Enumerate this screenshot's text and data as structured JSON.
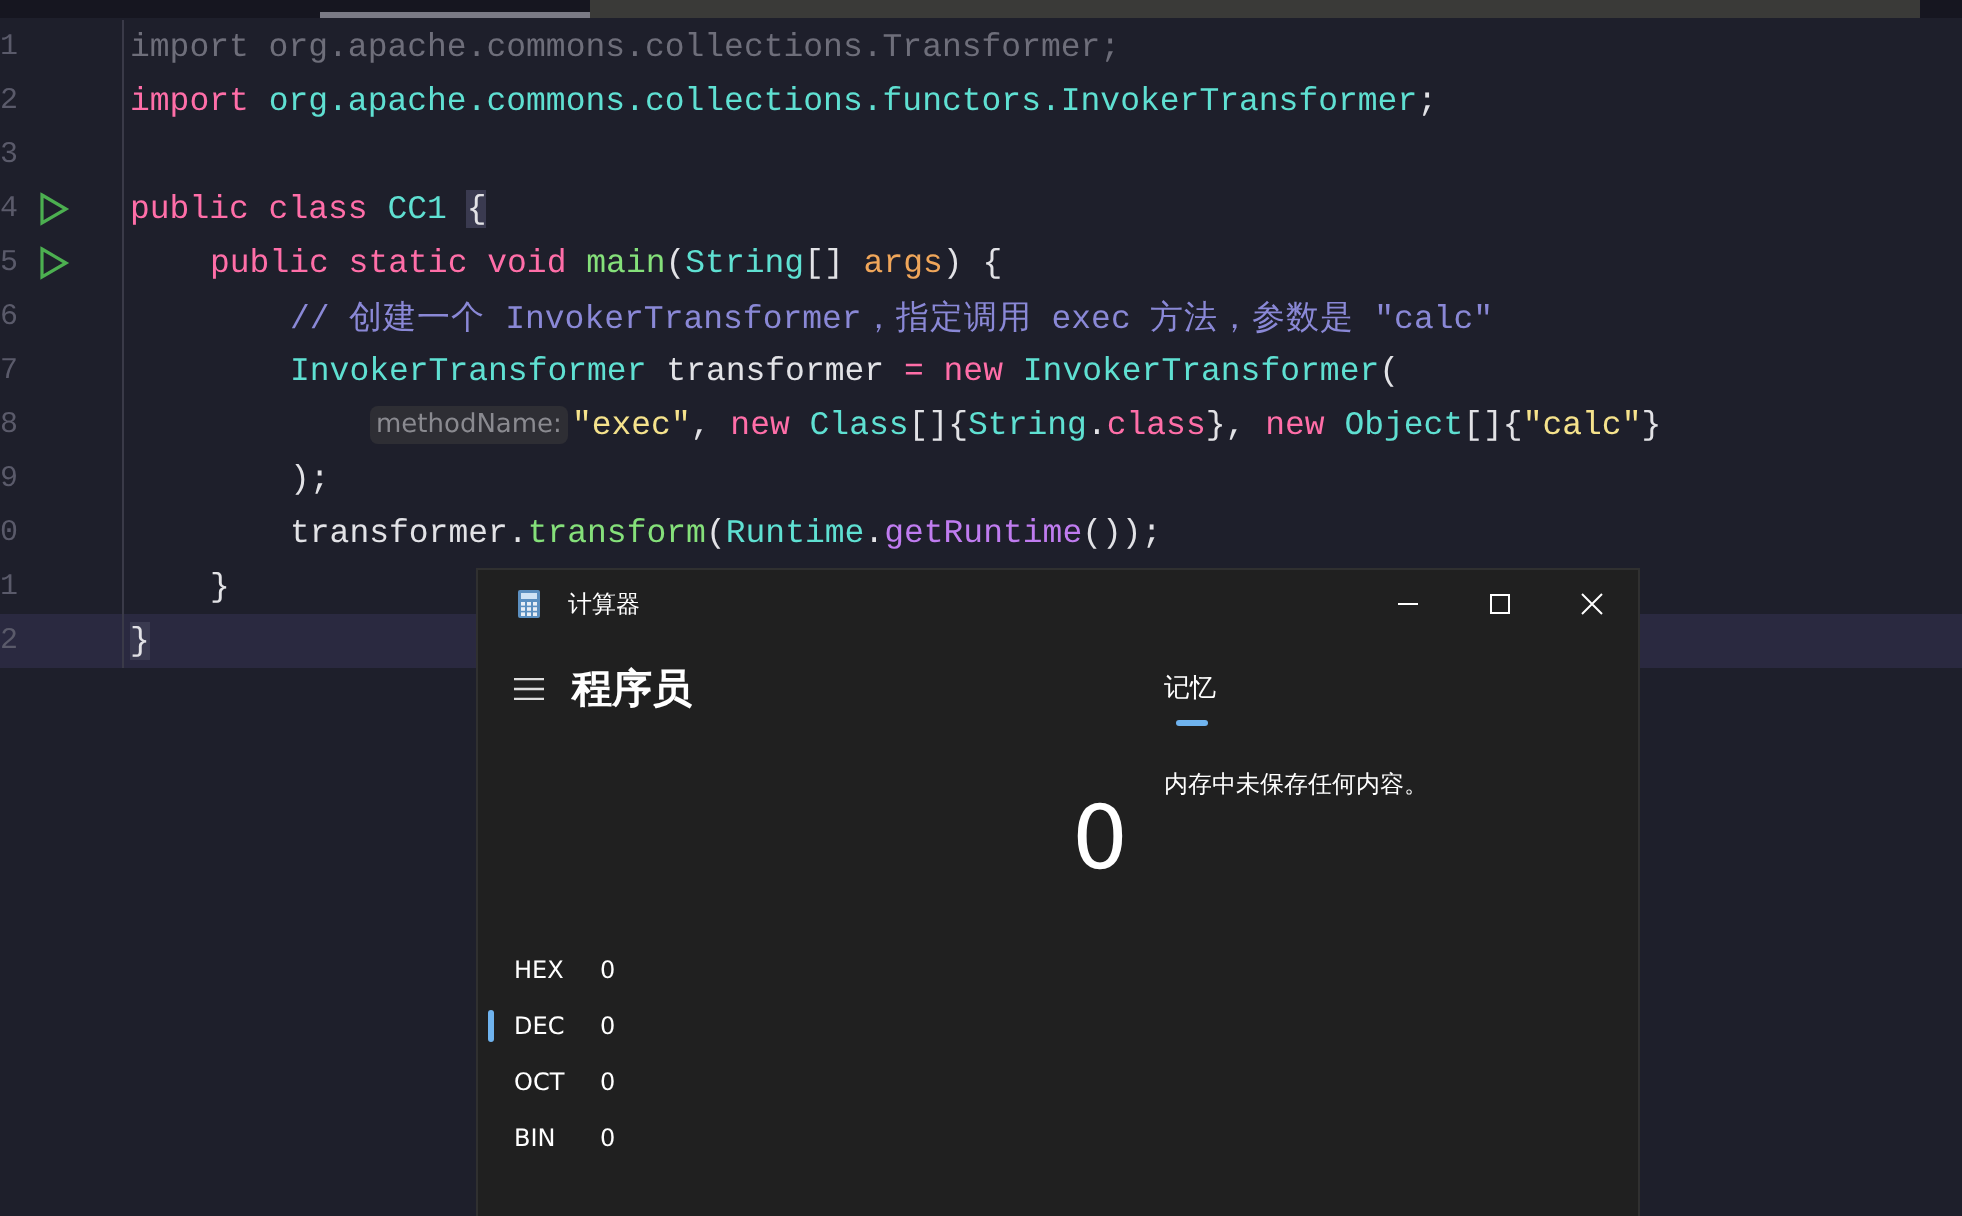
{
  "editor": {
    "lines": [
      {
        "number": "1",
        "tokens": [
          {
            "kind": "unused",
            "text": "import org.apache.commons.collections.Transformer;"
          }
        ]
      },
      {
        "number": "2",
        "tokens": [
          {
            "kind": "keyword",
            "text": "import "
          },
          {
            "kind": "type",
            "text": "org.apache.commons.collections.functors.InvokerTransformer"
          },
          {
            "kind": "plain",
            "text": ";"
          }
        ]
      },
      {
        "number": "3"
      },
      {
        "number": "4",
        "run_icon": true,
        "tokens": [
          {
            "kind": "keyword",
            "text": "public class "
          },
          {
            "kind": "type",
            "text": "CC1 "
          },
          {
            "kind": "brace",
            "text": "{"
          }
        ],
        "children": [
          {
            "number": "5",
            "run_icon": true,
            "tokens": [
              {
                "kind": "keyword",
                "text": "public static void "
              },
              {
                "kind": "method",
                "text": "main"
              },
              {
                "kind": "plain",
                "text": "("
              },
              {
                "kind": "type",
                "text": "String"
              },
              {
                "kind": "plain",
                "text": "[] "
              },
              {
                "kind": "param",
                "text": "args"
              },
              {
                "kind": "plain",
                "text": ") {"
              }
            ],
            "children": [
              {
                "number": "6",
                "tokens": [
                  {
                    "kind": "comment",
                    "text": "// 创建一个 InvokerTransformer，指定调用 exec 方法，参数是 \"calc\""
                  }
                ]
              },
              {
                "number": "7",
                "tokens": [
                  {
                    "kind": "type",
                    "text": "InvokerTransformer "
                  },
                  {
                    "kind": "plain",
                    "text": "transformer "
                  },
                  {
                    "kind": "keyword",
                    "text": "= new "
                  },
                  {
                    "kind": "type",
                    "text": "InvokerTransformer"
                  },
                  {
                    "kind": "plain",
                    "text": "("
                  }
                ],
                "children": [
                  {
                    "number": "8",
                    "tokens": [
                      {
                        "kind": "hint",
                        "text": "methodName:"
                      },
                      {
                        "kind": "string",
                        "text": "\"exec\""
                      },
                      {
                        "kind": "plain",
                        "text": ", "
                      },
                      {
                        "kind": "keyword",
                        "text": "new "
                      },
                      {
                        "kind": "type",
                        "text": "Class"
                      },
                      {
                        "kind": "plain",
                        "text": "[]{"
                      },
                      {
                        "kind": "type",
                        "text": "String"
                      },
                      {
                        "kind": "plain",
                        "text": "."
                      },
                      {
                        "kind": "keyword",
                        "text": "class"
                      },
                      {
                        "kind": "plain",
                        "text": "}, "
                      },
                      {
                        "kind": "keyword",
                        "text": "new "
                      },
                      {
                        "kind": "type",
                        "text": "Object"
                      },
                      {
                        "kind": "plain",
                        "text": "[]{"
                      },
                      {
                        "kind": "string",
                        "text": "\"calc\""
                      },
                      {
                        "kind": "plain",
                        "text": "}"
                      }
                    ]
                  }
                ]
              },
              {
                "number": "9",
                "tokens": [
                  {
                    "kind": "plain",
                    "text": ");"
                  }
                ]
              },
              {
                "number": "0",
                "tokens": [
                  {
                    "kind": "plain",
                    "text": "transformer."
                  },
                  {
                    "kind": "method",
                    "text": "transform"
                  },
                  {
                    "kind": "plain",
                    "text": "("
                  },
                  {
                    "kind": "type",
                    "text": "Runtime"
                  },
                  {
                    "kind": "plain",
                    "text": "."
                  },
                  {
                    "kind": "call",
                    "text": "getRuntime"
                  },
                  {
                    "kind": "plain",
                    "text": "());"
                  }
                ]
              }
            ]
          },
          {
            "number": "1",
            "tokens": [
              {
                "kind": "plain",
                "text": "}"
              }
            ]
          }
        ]
      },
      {
        "number": "2",
        "highlighted": true,
        "tokens": [
          {
            "kind": "brace",
            "text": "}"
          }
        ]
      }
    ]
  },
  "calculator": {
    "title": "计算器",
    "mode": "程序员",
    "display": "0",
    "radix": [
      {
        "label": "HEX",
        "value": "0",
        "selected": false
      },
      {
        "label": "DEC",
        "value": "0",
        "selected": true
      },
      {
        "label": "OCT",
        "value": "0",
        "selected": false
      },
      {
        "label": "BIN",
        "value": "0",
        "selected": false
      }
    ],
    "memory_tab": {
      "label": "记忆",
      "selected": true
    },
    "memory_message": "内存中未保存任何内容。"
  }
}
